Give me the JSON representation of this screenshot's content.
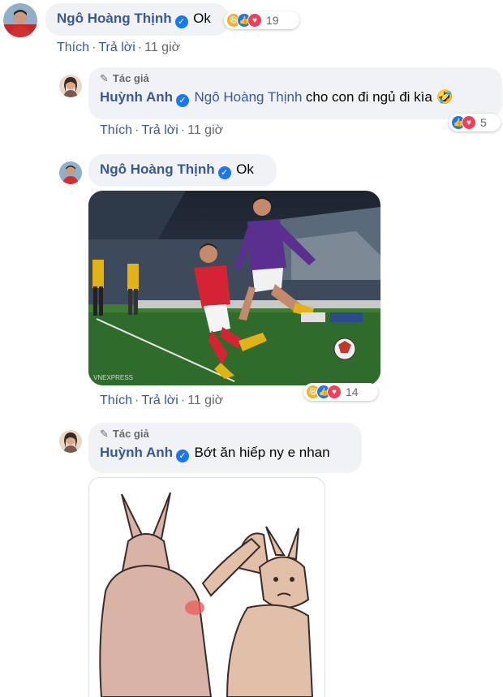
{
  "comment1": {
    "author": "Ngô Hoàng Thịnh",
    "text": "Ok",
    "reaction_count": "19",
    "actions": {
      "like": "Thích",
      "reply": "Trả lời",
      "time": "11 giờ"
    }
  },
  "reply1": {
    "badge": "Tác giả",
    "author": "Huỳnh Anh",
    "mention": "Ngô Hoàng Thịnh",
    "text": "cho con đi ngủ đi kìa 🤣",
    "reaction_count": "5",
    "actions": {
      "like": "Thích",
      "reply": "Trả lời",
      "time": "11 giờ"
    }
  },
  "reply2": {
    "author": "Ngô Hoàng Thịnh",
    "text": "Ok",
    "watermark": "VNEXPRESS",
    "reaction_count": "14",
    "actions": {
      "like": "Thích",
      "reply": "Trả lời",
      "time": "11 giờ"
    }
  },
  "reply3": {
    "badge": "Tác giả",
    "author": "Huỳnh Anh",
    "text": "Bớt ăn hiếp ny e nhan"
  },
  "icons": {
    "verified": "verified-badge-icon",
    "pencil": "pencil-icon",
    "haha": "haha-reaction-icon",
    "like": "like-reaction-icon",
    "love": "love-reaction-icon"
  },
  "colors": {
    "link": "#385898",
    "bubble": "#f0f2f5",
    "like": "#1877f2",
    "love": "#f33e58",
    "haha": "#f7b125"
  }
}
